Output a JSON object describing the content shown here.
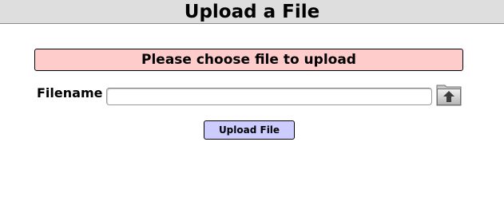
{
  "header": {
    "title": "Upload a File"
  },
  "message": {
    "text": "Please choose file to upload",
    "background_color": "#ffcccc"
  },
  "form": {
    "filename_label": "Filename",
    "filename_value": "",
    "browse_icon": "folder-upload-icon",
    "upload_button_label": "Upload File",
    "upload_button_color": "#ccccff"
  }
}
